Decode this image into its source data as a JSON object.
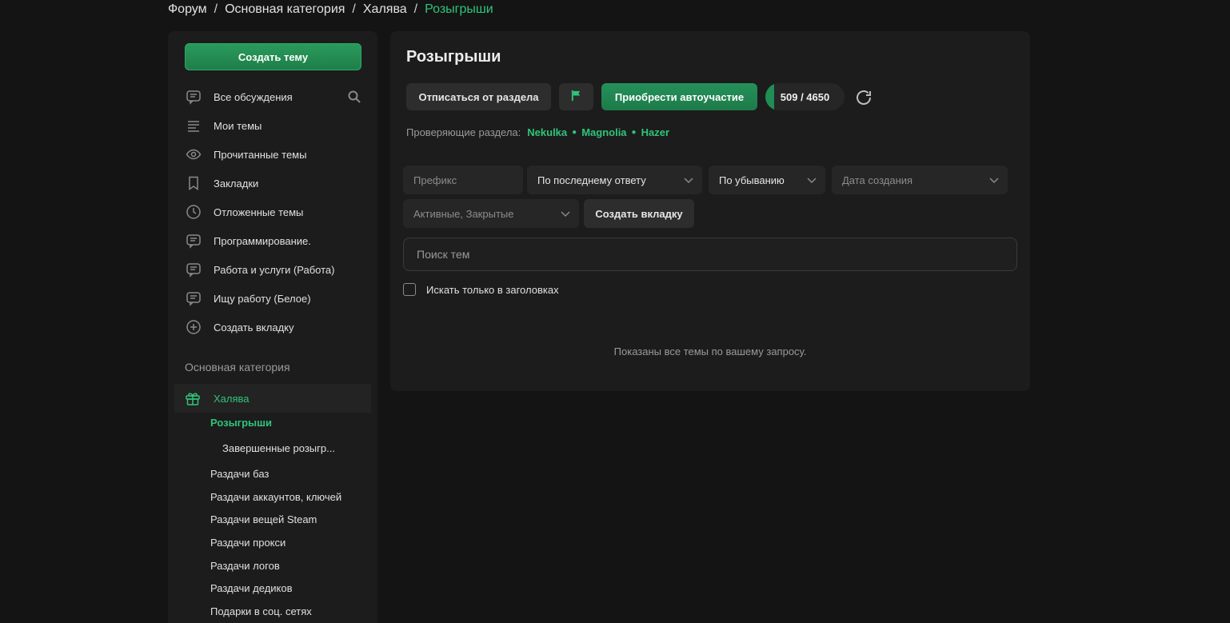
{
  "breadcrumb": {
    "items": [
      "Форум",
      "Основная категория",
      "Халява"
    ],
    "separator": "/",
    "current": "Розыгрыши"
  },
  "sidebar": {
    "create_topic": "Создать тему",
    "nav": [
      {
        "label": "Все обсуждения",
        "icon": "chat-icon"
      },
      {
        "label": "Мои темы",
        "icon": "list-icon"
      },
      {
        "label": "Прочитанные темы",
        "icon": "eye-icon"
      },
      {
        "label": "Закладки",
        "icon": "bookmark-icon"
      },
      {
        "label": "Отложенные темы",
        "icon": "clock-icon"
      },
      {
        "label": "Программирование.",
        "icon": "chat-icon"
      },
      {
        "label": "Работа и услуги (Работа)",
        "icon": "chat-icon"
      },
      {
        "label": "Ищу работу (Белое)",
        "icon": "chat-icon"
      },
      {
        "label": "Создать вкладку",
        "icon": "plus-circle-icon"
      }
    ],
    "section_title": "Основная категория",
    "active_category": {
      "label": "Халява",
      "icon": "gift-icon"
    },
    "subitems": [
      {
        "label": "Розыгрыши"
      },
      {
        "label": "Завершенные розыгр..."
      },
      {
        "label": "Раздачи баз"
      },
      {
        "label": "Раздачи аккаунтов, ключей"
      },
      {
        "label": "Раздачи вещей Steam"
      },
      {
        "label": "Раздачи прокси"
      },
      {
        "label": "Раздачи логов"
      },
      {
        "label": "Раздачи дедиков"
      },
      {
        "label": "Подарки в соц. сетях"
      }
    ]
  },
  "main": {
    "title": "Розыгрыши",
    "unsubscribe_label": "Отписаться от раздела",
    "auto_participation_label": "Приобрести автоучастие",
    "counter_text": "509 / 4650",
    "counter_progress": 0.109,
    "moderators_label": "Проверяющие раздела:",
    "moderators": [
      "Nekulka",
      "Magnolia",
      "Hazer"
    ],
    "filters": {
      "prefix_placeholder": "Префикс",
      "sort_by": "По последнему ответу",
      "order": "По убыванию",
      "date_placeholder": "Дата создания",
      "state_placeholder": "Активные, Закрытые",
      "create_tab_label": "Создать вкладку"
    },
    "search_placeholder": "Поиск тем",
    "titles_only_label": "Искать только в заголовках",
    "empty_message": "Показаны все темы по вашему запросу."
  },
  "colors": {
    "accent": "#2fc47a",
    "button_green": "#1f8d54",
    "background": "#141414",
    "panel": "#1c1c1c"
  }
}
